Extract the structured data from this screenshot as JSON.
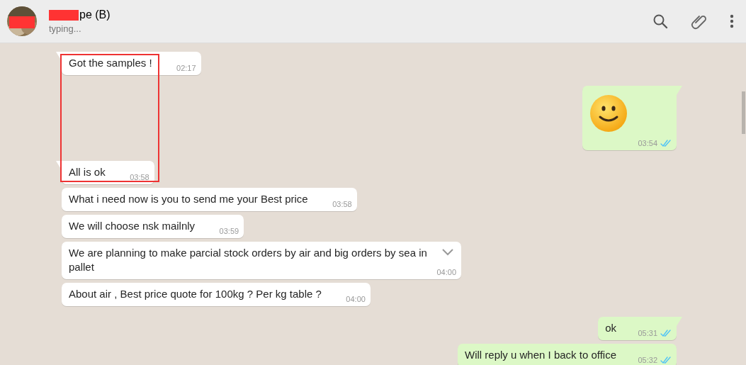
{
  "header": {
    "name": "pe (B)",
    "name_redacted": true,
    "status": "typing..."
  },
  "messages": [
    {
      "outgoing": false,
      "kind": "text",
      "text": "Got the samples !",
      "time": "02:17",
      "tail": true
    },
    {
      "outgoing": true,
      "kind": "emoji",
      "time": "03:54",
      "tail": true,
      "read": true
    },
    {
      "outgoing": false,
      "kind": "text",
      "text": "All is ok",
      "time": "03:58",
      "tail": true
    },
    {
      "outgoing": false,
      "kind": "text",
      "text": "What i need now is you to send me your Best price",
      "time": "03:58",
      "tail": false
    },
    {
      "outgoing": false,
      "kind": "text",
      "text": "We will choose nsk mailnly",
      "time": "03:59",
      "tail": false
    },
    {
      "outgoing": false,
      "kind": "text",
      "text": "We are planning to make parcial stock orders by air and big orders by sea in pallet",
      "time": "04:00",
      "tail": false,
      "hovered": true
    },
    {
      "outgoing": false,
      "kind": "text",
      "text": "About air , Best price quote for 100kg ? Per kg table ?",
      "time": "04:00",
      "tail": false
    },
    {
      "outgoing": true,
      "kind": "text",
      "text": "ok",
      "time": "05:31",
      "tail": true,
      "read": true
    },
    {
      "outgoing": true,
      "kind": "text",
      "text": "Will reply u when I back to office",
      "time": "05:32",
      "tail": false,
      "read": true
    }
  ],
  "annotation": {
    "kind": "frame",
    "color": "#ee3333"
  }
}
